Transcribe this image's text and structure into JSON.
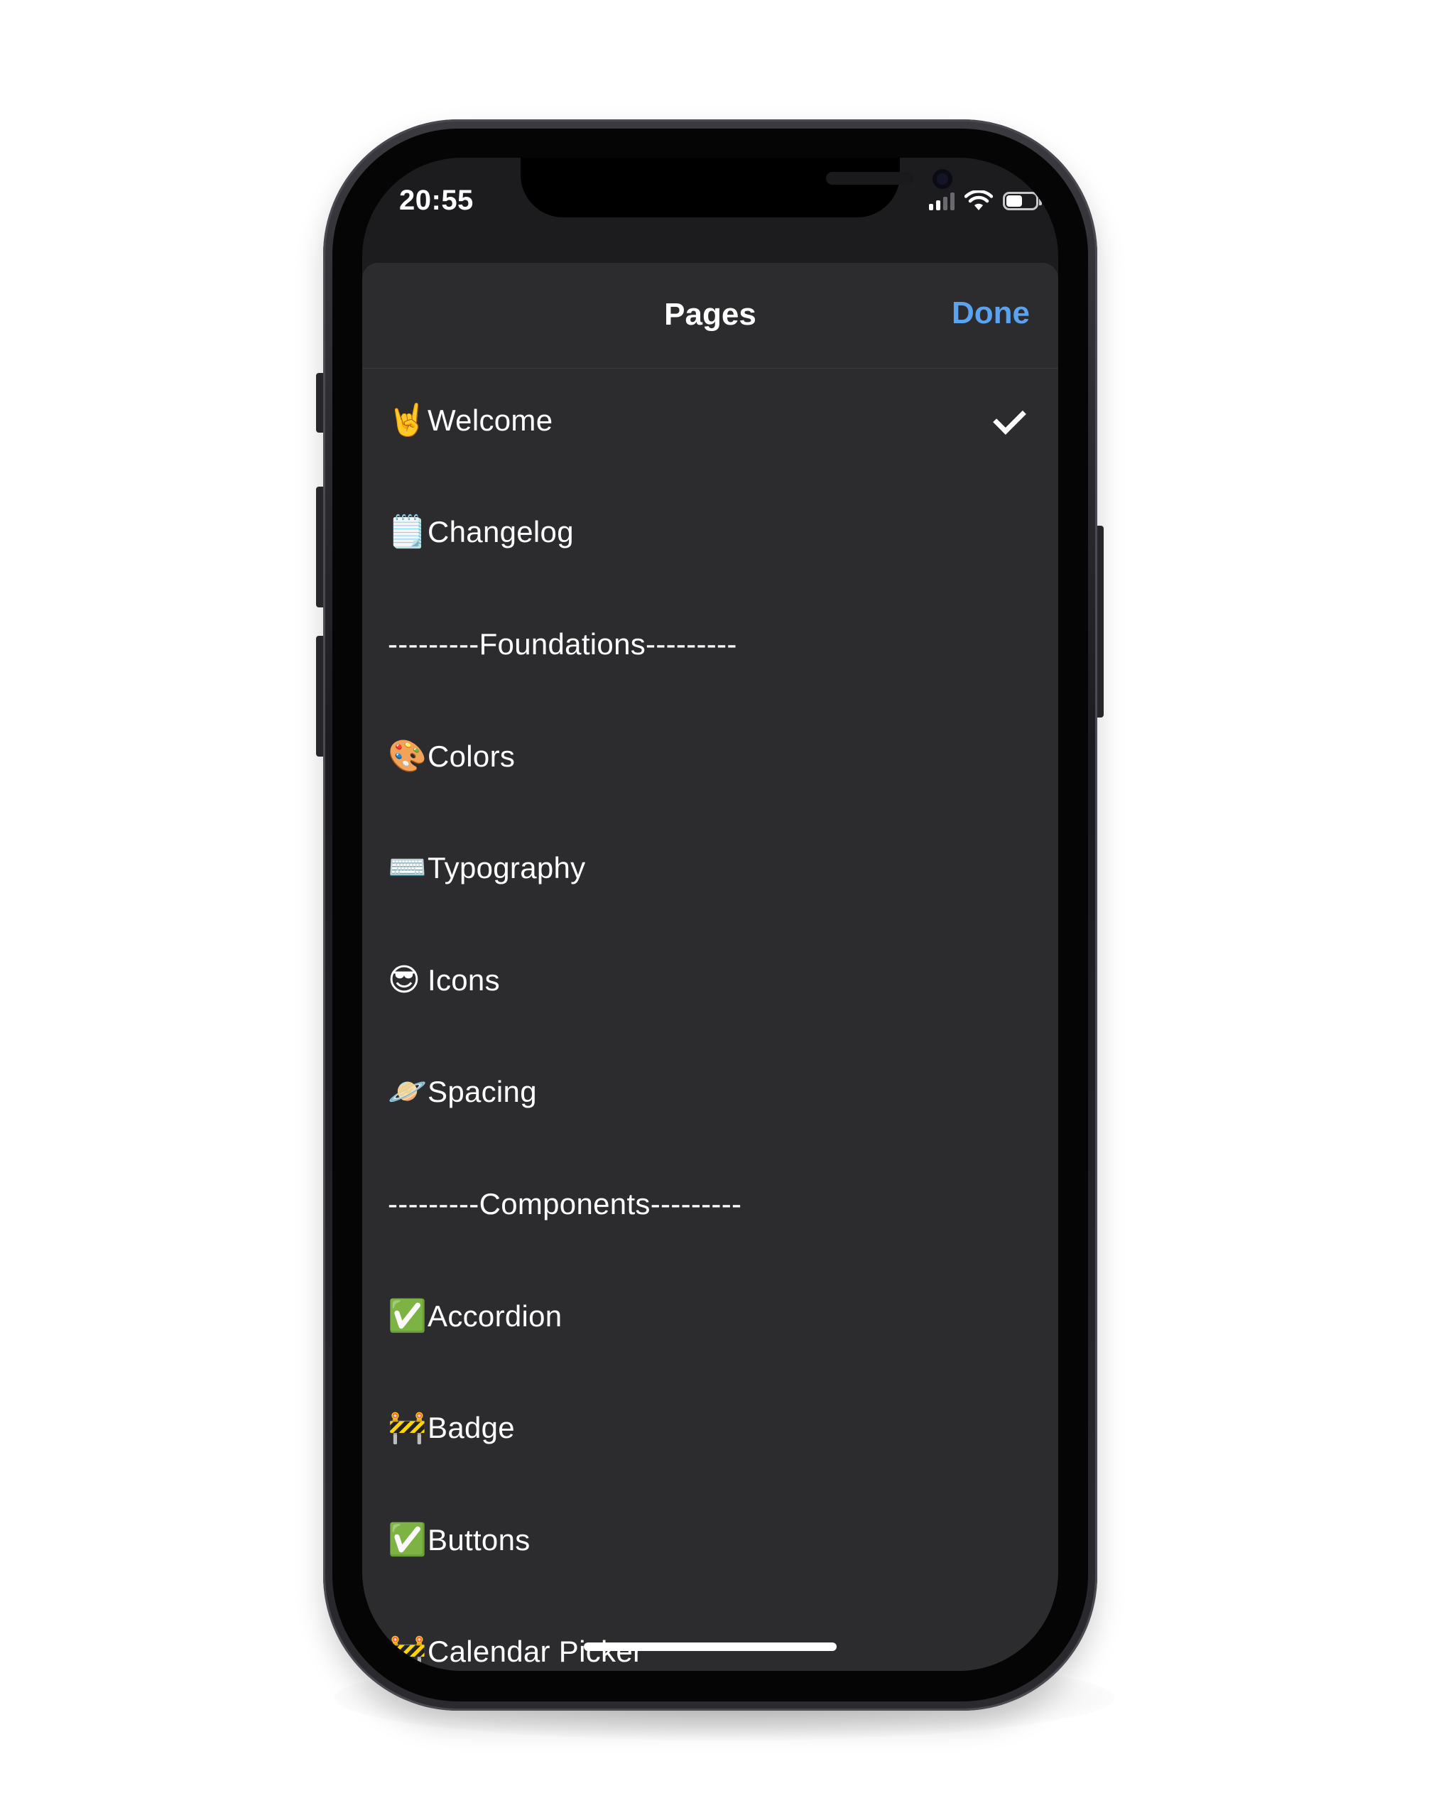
{
  "status_bar": {
    "time": "20:55",
    "signal_bars": 4,
    "signal_active": 2,
    "battery_level": 0.55
  },
  "sheet": {
    "title": "Pages",
    "done_label": "Done",
    "accent_color": "#5aa3f0",
    "background_color": "#2c2c2e"
  },
  "pages": [
    {
      "emoji": "🤘",
      "label": "Welcome",
      "selected": true
    },
    {
      "emoji": "🗒️",
      "label": "Changelog",
      "selected": false
    },
    {
      "emoji": "",
      "label": "---------Foundations---------",
      "selected": false
    },
    {
      "emoji": "🎨",
      "label": "Colors",
      "selected": false
    },
    {
      "emoji": "⌨️",
      "label": "Typography",
      "selected": false
    },
    {
      "emoji": "😎",
      "label": "Icons",
      "selected": false
    },
    {
      "emoji": "🪐",
      "label": "Spacing",
      "selected": false
    },
    {
      "emoji": "",
      "label": "---------Components---------",
      "selected": false
    },
    {
      "emoji": "✅",
      "label": "Accordion",
      "selected": false
    },
    {
      "emoji": "🚧",
      "label": "Badge",
      "selected": false
    },
    {
      "emoji": "✅",
      "label": "Buttons",
      "selected": false
    },
    {
      "emoji": "🚧",
      "label": "Calendar Picker",
      "selected": false
    }
  ]
}
